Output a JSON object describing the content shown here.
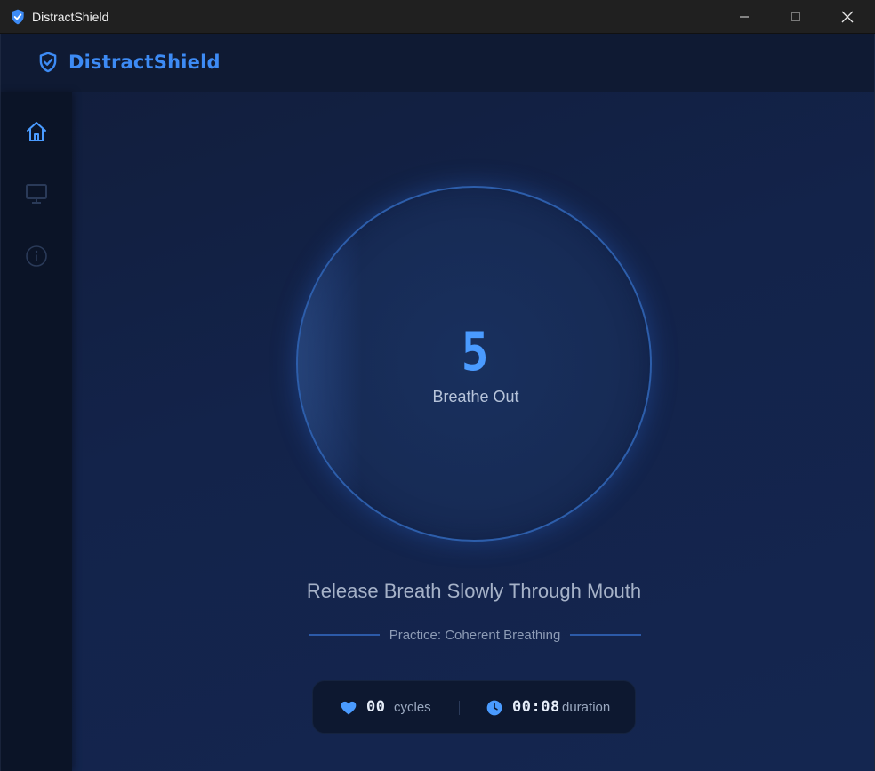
{
  "window": {
    "title": "DistractShield",
    "minimize_icon": "minimize-icon",
    "maximize_icon": "maximize-icon",
    "close_icon": "close-icon"
  },
  "header": {
    "brand": "DistractShield",
    "brand_icon": "shield-check-icon",
    "brand_color": "#3d8bf5"
  },
  "sidebar": {
    "items": [
      {
        "id": "home",
        "icon": "home-icon",
        "active": true
      },
      {
        "id": "monitor",
        "icon": "monitor-icon",
        "active": false
      },
      {
        "id": "info",
        "icon": "info-icon",
        "active": false
      }
    ]
  },
  "breathing": {
    "countdown": "5",
    "phase": "Breathe Out",
    "instruction": "Release Breath Slowly Through Mouth",
    "practice": "Practice: Coherent Breathing"
  },
  "stats": {
    "cycles_value": "00",
    "cycles_label": "cycles",
    "duration_value": "00:08",
    "duration_label": "duration",
    "cycles_icon": "heart-icon",
    "duration_icon": "clock-icon"
  },
  "colors": {
    "accent": "#3d8bf5",
    "digit": "#4a9bff",
    "background": "#13234a"
  }
}
